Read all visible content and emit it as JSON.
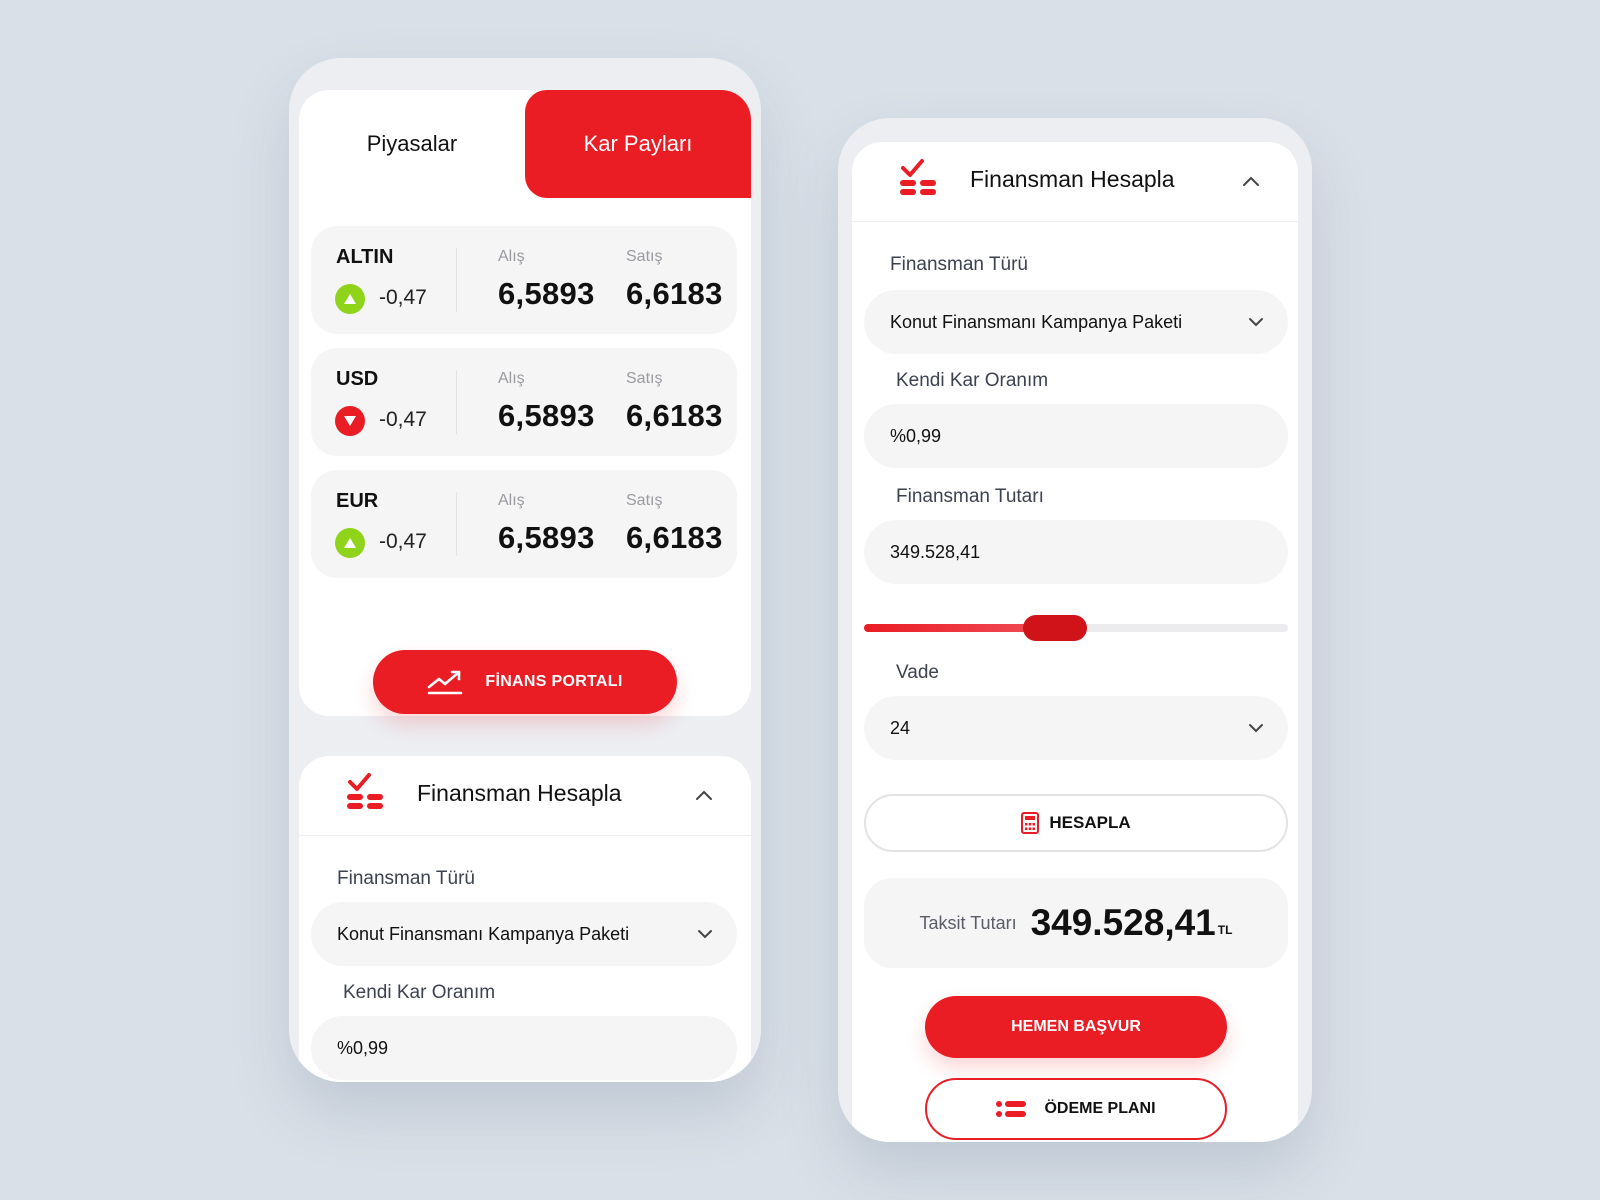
{
  "markets": {
    "tabs": [
      {
        "label": "Piyasalar",
        "active": false
      },
      {
        "label": "Kar Payları",
        "active": true
      }
    ],
    "col_buy": "Alış",
    "col_sell": "Satış",
    "rates": [
      {
        "name": "ALTIN",
        "trend": "up",
        "change": "-0,47",
        "buy": "6,5893",
        "sell": "6,6183"
      },
      {
        "name": "USD",
        "trend": "down",
        "change": "-0,47",
        "buy": "6,5893",
        "sell": "6,6183"
      },
      {
        "name": "EUR",
        "trend": "up",
        "change": "-0,47",
        "buy": "6,5893",
        "sell": "6,6183"
      }
    ],
    "portal_button": "FİNANS PORTALI"
  },
  "calculator": {
    "title": "Finansman Hesapla",
    "type_label": "Finansman Türü",
    "type_value": "Konut Finansmanı Kampanya Paketi",
    "rate_label": "Kendi Kar Oranım",
    "rate_value": "%0,99",
    "amount_label": "Finansman Tutarı",
    "amount_value": "349.528,41",
    "amount_slider_fraction": 0.45,
    "term_label": "Vade",
    "term_value": "24",
    "calc_button": "HESAPLA",
    "result_label": "Taksit Tutarı",
    "result_value": "349.528,41",
    "result_unit": "TL",
    "apply_button": "HEMEN BAŞVUR",
    "plan_button": "ÖDEME PLANI"
  },
  "colors": {
    "accent": "#ea1c24",
    "up": "#8fd41a",
    "down": "#ea1c24",
    "background": "#d9e0e8"
  },
  "icons": {
    "trend_up": "triangle-up-icon",
    "trend_down": "triangle-down-icon",
    "portal": "chart-trend-icon",
    "logo": "finance-check-stack-icon",
    "calc": "calculator-icon",
    "plan": "list-icon",
    "collapse": "chevron-up-icon",
    "dropdown": "chevron-down-icon"
  }
}
